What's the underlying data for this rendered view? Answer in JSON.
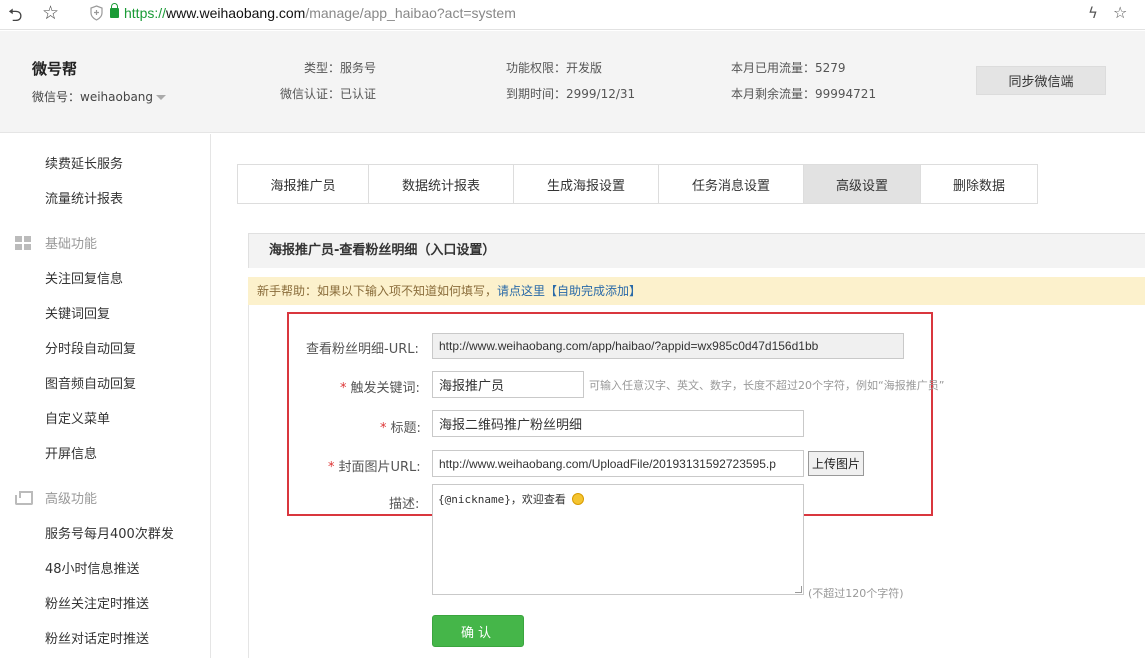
{
  "browser": {
    "url_protocol": "https://",
    "url_host": "www.weihaobang.com",
    "url_path": "/manage/app_haibao?act=system"
  },
  "account": {
    "name": "微号帮",
    "wechat_id": "微信号：weihaobang",
    "type": "类型：服务号",
    "verified": "微信认证：已认证",
    "permission": "功能权限：开发版",
    "expiry": "到期时间：2999/12/31",
    "used_traffic": "本月已用流量：5279",
    "remaining_traffic": "本月剩余流量：99994721",
    "sync_label": "同步微信端"
  },
  "sidebar": {
    "top_items": [
      "续费延长服务",
      "流量统计报表"
    ],
    "group_basic": "基础功能",
    "basic_items": [
      "关注回复信息",
      "关键词回复",
      "分时段自动回复",
      "图音频自动回复",
      "自定义菜单",
      "开屏信息"
    ],
    "group_advanced": "高级功能",
    "advanced_items": [
      "服务号每月400次群发",
      "48小时信息推送",
      "粉丝关注定时推送",
      "粉丝对话定时推送"
    ]
  },
  "tabs": [
    {
      "label": "海报推广员"
    },
    {
      "label": "数据统计报表"
    },
    {
      "label": "生成海报设置"
    },
    {
      "label": "任务消息设置"
    },
    {
      "label": "高级设置"
    },
    {
      "label": "删除数据"
    }
  ],
  "panel": {
    "title": "海报推广员-查看粉丝明细（入口设置）",
    "help_prefix": "新手帮助：如果以下输入项不知道如何填写，",
    "help_link": "请点这里【自助完成添加】"
  },
  "form": {
    "url_label": "查看粉丝明细-URL:",
    "url_value": "http://www.weihaobang.com/app/haibao/?appid=wx985c0d47d156d1bb",
    "keyword_label": "触发关键词:",
    "keyword_value": "海报推广员",
    "keyword_hint": "可输入任意汉字、英文、数字，长度不超过20个字符，例如“海报推广员”",
    "title_label": "标题:",
    "title_value": "海报二维码推广粉丝明细",
    "cover_label": "封面图片URL:",
    "cover_value": "http://www.weihaobang.com/UploadFile/20193131592723595.p",
    "upload_label": "上传图片",
    "desc_label": "描述:",
    "desc_value": "{@nickname}，欢迎查看",
    "desc_hint": "(不超过120个字符)",
    "required_mark": "*",
    "confirm_label": "确认"
  }
}
